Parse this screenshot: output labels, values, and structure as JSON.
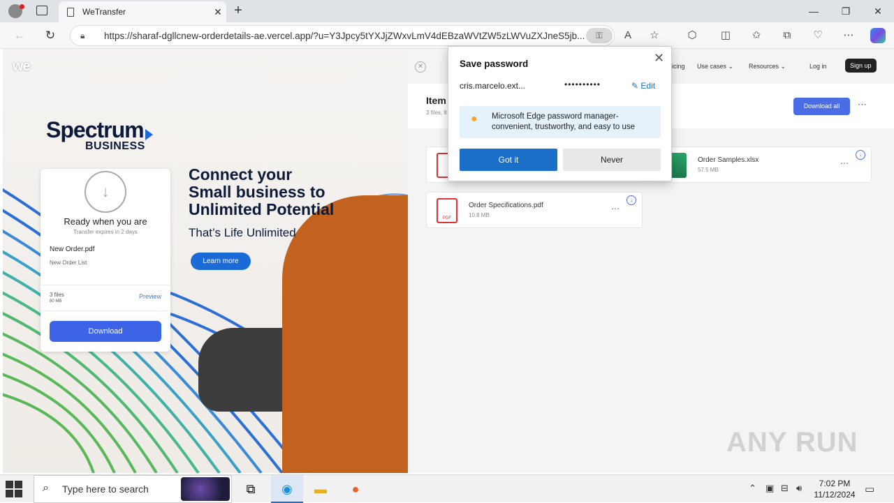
{
  "browser": {
    "tab_title": "WeTransfer",
    "url": "https://sharaf-dgllcnew-orderdetails-ae.vercel.app/?u=Y3Jpcy5tYXJjZWxvLmV4dEBzaWVtZW5zLWVuZXJneS5jb..."
  },
  "left": {
    "logo": "we",
    "brand_main": "Spectrum",
    "brand_sub": "BUSINESS",
    "headline_l1": "Connect your",
    "headline_l2": "Small business to",
    "headline_l3": "Unlimited Potential",
    "tagline": "That’s Life Unlimited",
    "learn_more": "Learn more",
    "card": {
      "title": "Ready when you are",
      "expires": "Transfer expires in 2 days",
      "file_name": "New Order.pdf",
      "file_desc": "New Order List",
      "files_count": "3 files",
      "total_size": "80 MB",
      "preview": "Preview",
      "download": "Download"
    }
  },
  "right": {
    "nav_pricing": "icing",
    "nav_use_cases": "Use cases",
    "nav_resources": "Resources",
    "nav_login": "Log in",
    "nav_signup": "Sign up",
    "items_title": "Item",
    "items_sub": "3 files, 8",
    "download_all": "Download all",
    "files": [
      {
        "name": "Order Samples.xlsx",
        "size": "57.5 MB"
      },
      {
        "name": "Order Specifications.pdf",
        "size": "10.8 MB"
      }
    ],
    "pdf_label": "PDF"
  },
  "popup": {
    "title": "Save password",
    "username": "cris.marcelo.ext...",
    "password": "••••••••••",
    "edit": "Edit",
    "info_text": "Microsoft Edge password manager- convenient, trustworthy, and easy to use",
    "got_it": "Got it",
    "never": "Never"
  },
  "watermark": "ANY RUN",
  "taskbar": {
    "search_placeholder": "Type here to search",
    "time": "7:02 PM",
    "date": "11/12/2024"
  }
}
